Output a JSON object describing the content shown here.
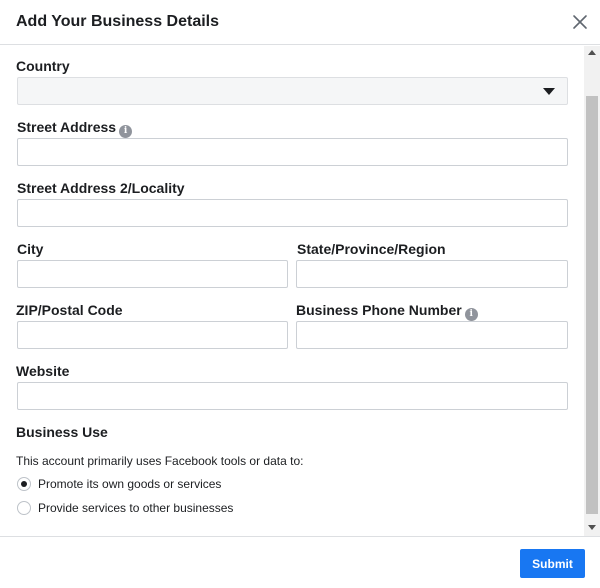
{
  "dialog": {
    "title": "Add Your Business Details"
  },
  "icons": {
    "close": "close-icon",
    "info": "info-icon",
    "caret": "chevron-down-icon"
  },
  "fields": {
    "country": {
      "label": "Country",
      "value": ""
    },
    "street_address": {
      "label": "Street Address",
      "value": "",
      "placeholder": ""
    },
    "street_address_2": {
      "label": "Street Address 2/Locality",
      "value": "",
      "placeholder": ""
    },
    "city": {
      "label": "City",
      "value": "",
      "placeholder": ""
    },
    "state": {
      "label": "State/Province/Region",
      "value": "",
      "placeholder": ""
    },
    "zip": {
      "label": "ZIP/Postal Code",
      "value": "",
      "placeholder": ""
    },
    "phone": {
      "label": "Business Phone Number",
      "value": "",
      "placeholder": ""
    },
    "website": {
      "label": "Website",
      "value": "",
      "placeholder": ""
    }
  },
  "business_use": {
    "label": "Business Use",
    "prompt": "This account primarily uses Facebook tools or data to:",
    "options": [
      {
        "label": "Promote its own goods or services",
        "selected": true
      },
      {
        "label": "Provide services to other businesses",
        "selected": false
      }
    ]
  },
  "footer": {
    "submit_label": "Submit"
  },
  "colors": {
    "accent": "#1877f2",
    "border": "#ccd0d5",
    "text": "#1c1e21"
  }
}
